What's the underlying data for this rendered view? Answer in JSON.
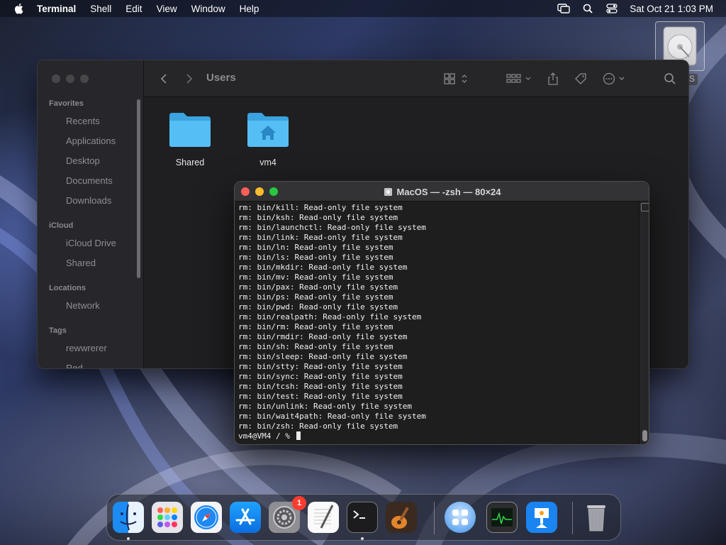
{
  "menubar": {
    "app_name": "Terminal",
    "items": [
      "Shell",
      "Edit",
      "View",
      "Window",
      "Help"
    ],
    "clock": "Sat Oct 21  1:03 PM"
  },
  "desktop": {
    "disk_icon": "hard-disk-icon",
    "disk_label": "S"
  },
  "finder": {
    "path_title": "Users",
    "sidebar": {
      "favorites_header": "Favorites",
      "favorites": [
        "Recents",
        "Applications",
        "Desktop",
        "Documents",
        "Downloads"
      ],
      "icloud_header": "iCloud",
      "icloud": [
        "iCloud Drive",
        "Shared"
      ],
      "locations_header": "Locations",
      "locations": [
        "Network"
      ],
      "tags_header": "Tags",
      "tags": [
        "rewwrerer",
        "Red"
      ]
    },
    "folders": [
      {
        "label": "Shared",
        "icon": "folder-icon"
      },
      {
        "label": "vm4",
        "icon": "home-folder-icon"
      }
    ],
    "folder_color": "#4fb8f0"
  },
  "terminal": {
    "title": "MacOS — -zsh — 80×24",
    "lines": [
      "rm: bin/kill: Read-only file system",
      "rm: bin/ksh: Read-only file system",
      "rm: bin/launchctl: Read-only file system",
      "rm: bin/link: Read-only file system",
      "rm: bin/ln: Read-only file system",
      "rm: bin/ls: Read-only file system",
      "rm: bin/mkdir: Read-only file system",
      "rm: bin/mv: Read-only file system",
      "rm: bin/pax: Read-only file system",
      "rm: bin/ps: Read-only file system",
      "rm: bin/pwd: Read-only file system",
      "rm: bin/realpath: Read-only file system",
      "rm: bin/rm: Read-only file system",
      "rm: bin/rmdir: Read-only file system",
      "rm: bin/sh: Read-only file system",
      "rm: bin/sleep: Read-only file system",
      "rm: bin/stty: Read-only file system",
      "rm: bin/sync: Read-only file system",
      "rm: bin/tcsh: Read-only file system",
      "rm: bin/test: Read-only file system",
      "rm: bin/unlink: Read-only file system",
      "rm: bin/wait4path: Read-only file system",
      "rm: bin/zsh: Read-only file system"
    ],
    "prompt": "vm4@VM4 / % "
  },
  "dock": {
    "apps": [
      {
        "name": "finder-icon",
        "running": true
      },
      {
        "name": "launchpad-icon",
        "running": false
      },
      {
        "name": "safari-icon",
        "running": false
      },
      {
        "name": "app-store-icon",
        "running": false
      },
      {
        "name": "system-settings-icon",
        "running": false,
        "badge": "1"
      },
      {
        "name": "textedit-icon",
        "running": false
      },
      {
        "name": "terminal-icon",
        "running": true
      },
      {
        "name": "garageband-icon",
        "running": false
      },
      {
        "name": "widgets-icon",
        "running": false
      },
      {
        "name": "activity-monitor-icon",
        "running": false
      },
      {
        "name": "keynote-icon",
        "running": false
      },
      {
        "name": "trash-icon",
        "running": false
      }
    ]
  }
}
